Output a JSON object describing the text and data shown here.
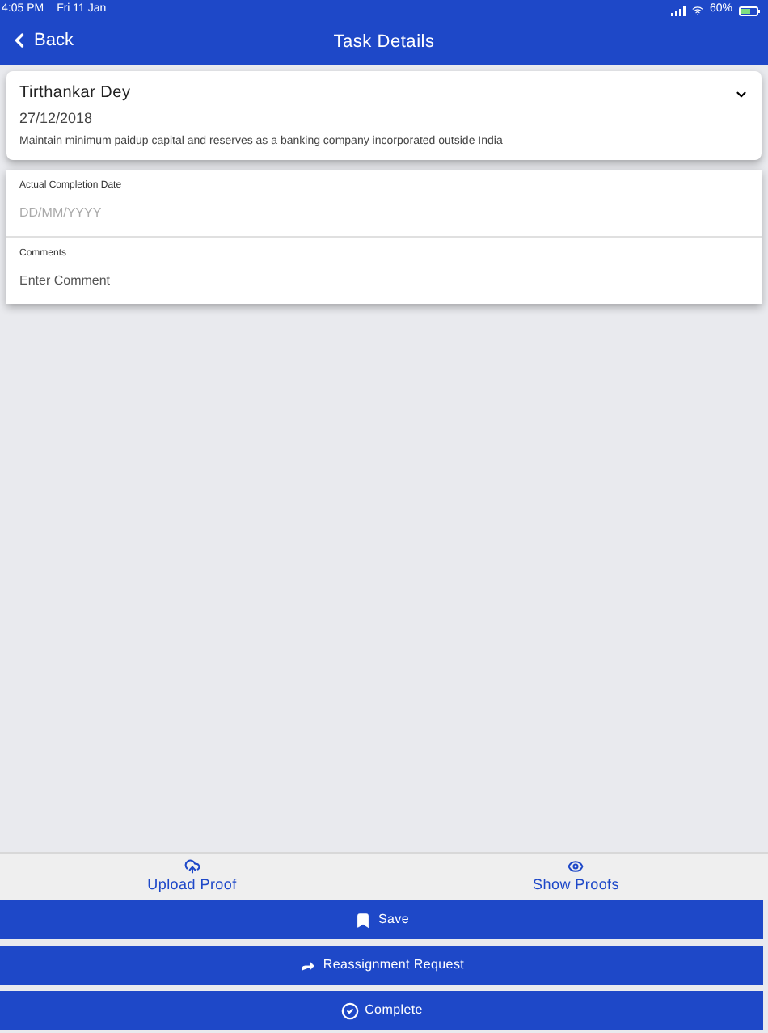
{
  "status_bar": {
    "time": "4:05 PM",
    "date": "Fri 11 Jan",
    "battery": "60%"
  },
  "nav_bar": {
    "back": "Back",
    "title": "Task Details"
  },
  "task_card": {
    "name": "Tirthankar Dey",
    "date": "27/12/2018",
    "description": "Maintain minimum paidup capital and reserves as a banking company incorporated outside India",
    "expanded": false
  },
  "form": [
    {
      "label": "Actual Completion Date",
      "placeholder": "DD/MM/YYYY"
    },
    {
      "label": "Comments",
      "placeholder": "Enter Comment"
    }
  ],
  "links": [
    {
      "kind": "upload",
      "label": "Upload Proof"
    },
    {
      "kind": "show",
      "label": "Show Proofs"
    }
  ],
  "buttons": [
    {
      "kind": "save",
      "label": "Save"
    },
    {
      "kind": "reassign",
      "label": "Reassignment Request"
    },
    {
      "kind": "complete",
      "label": "Complete"
    }
  ]
}
